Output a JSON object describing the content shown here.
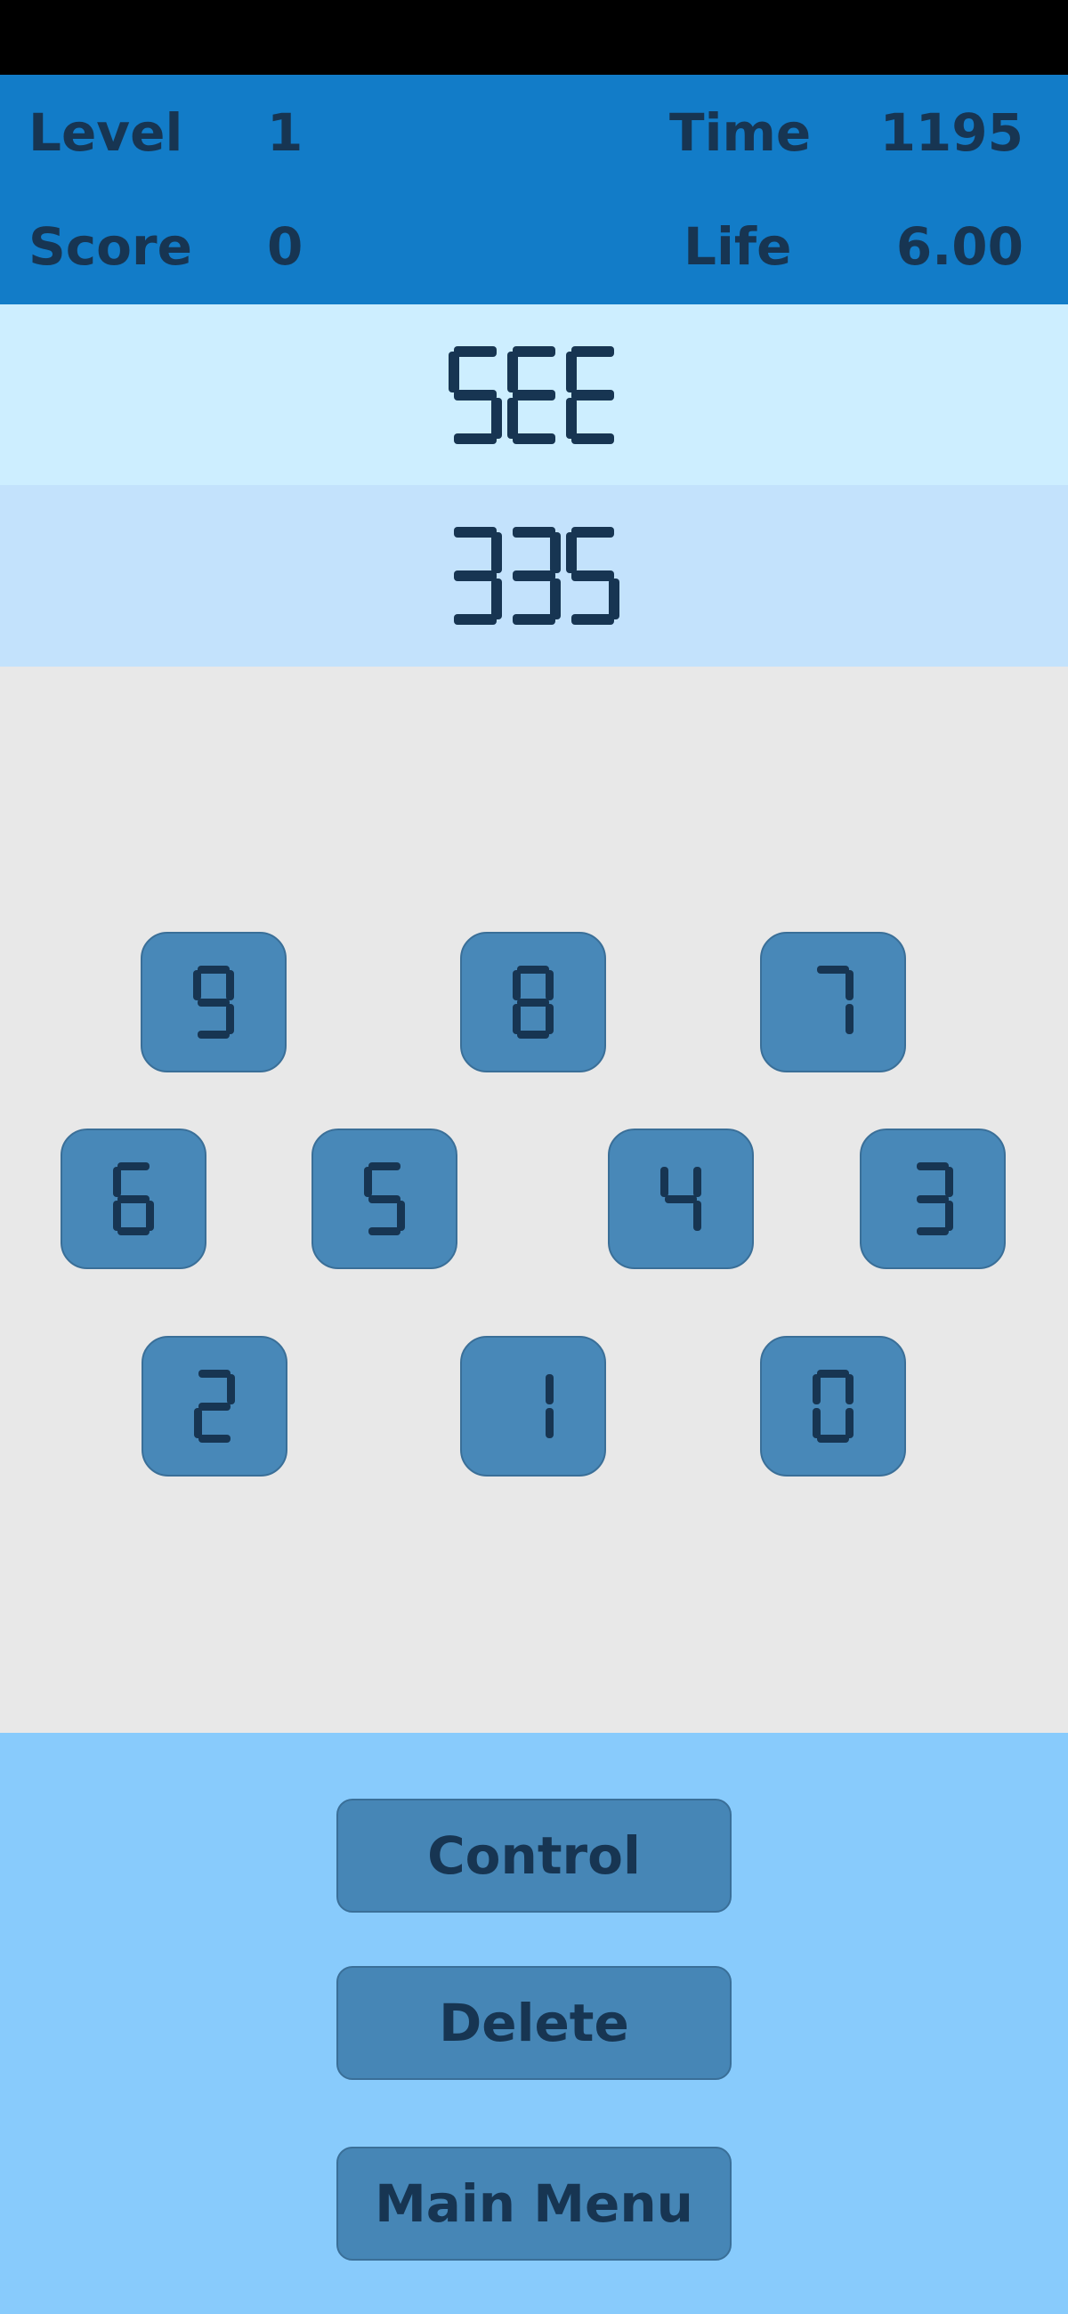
{
  "hud": {
    "level_label": "Level",
    "level_value": "1",
    "time_label": "Time",
    "time_value": "1195",
    "score_label": "Score",
    "score_value": "0",
    "life_label": "Life",
    "life_value": "6.00"
  },
  "target_word": "SEE",
  "input_number": "335",
  "keys": [
    "9",
    "8",
    "7",
    "6",
    "5",
    "4",
    "3",
    "2",
    "1",
    "0"
  ],
  "buttons": {
    "control": "Control",
    "delete": "Delete",
    "main_menu": "Main Menu"
  },
  "colors": {
    "hud_bg": "#127cc8",
    "target_bg": "#cdeeff",
    "input_bg": "#c3e2fc",
    "keypad_bg": "#e8e8e8",
    "key_bg": "#4888b8",
    "controls_bg": "#88cbfc",
    "text": "#173552"
  }
}
